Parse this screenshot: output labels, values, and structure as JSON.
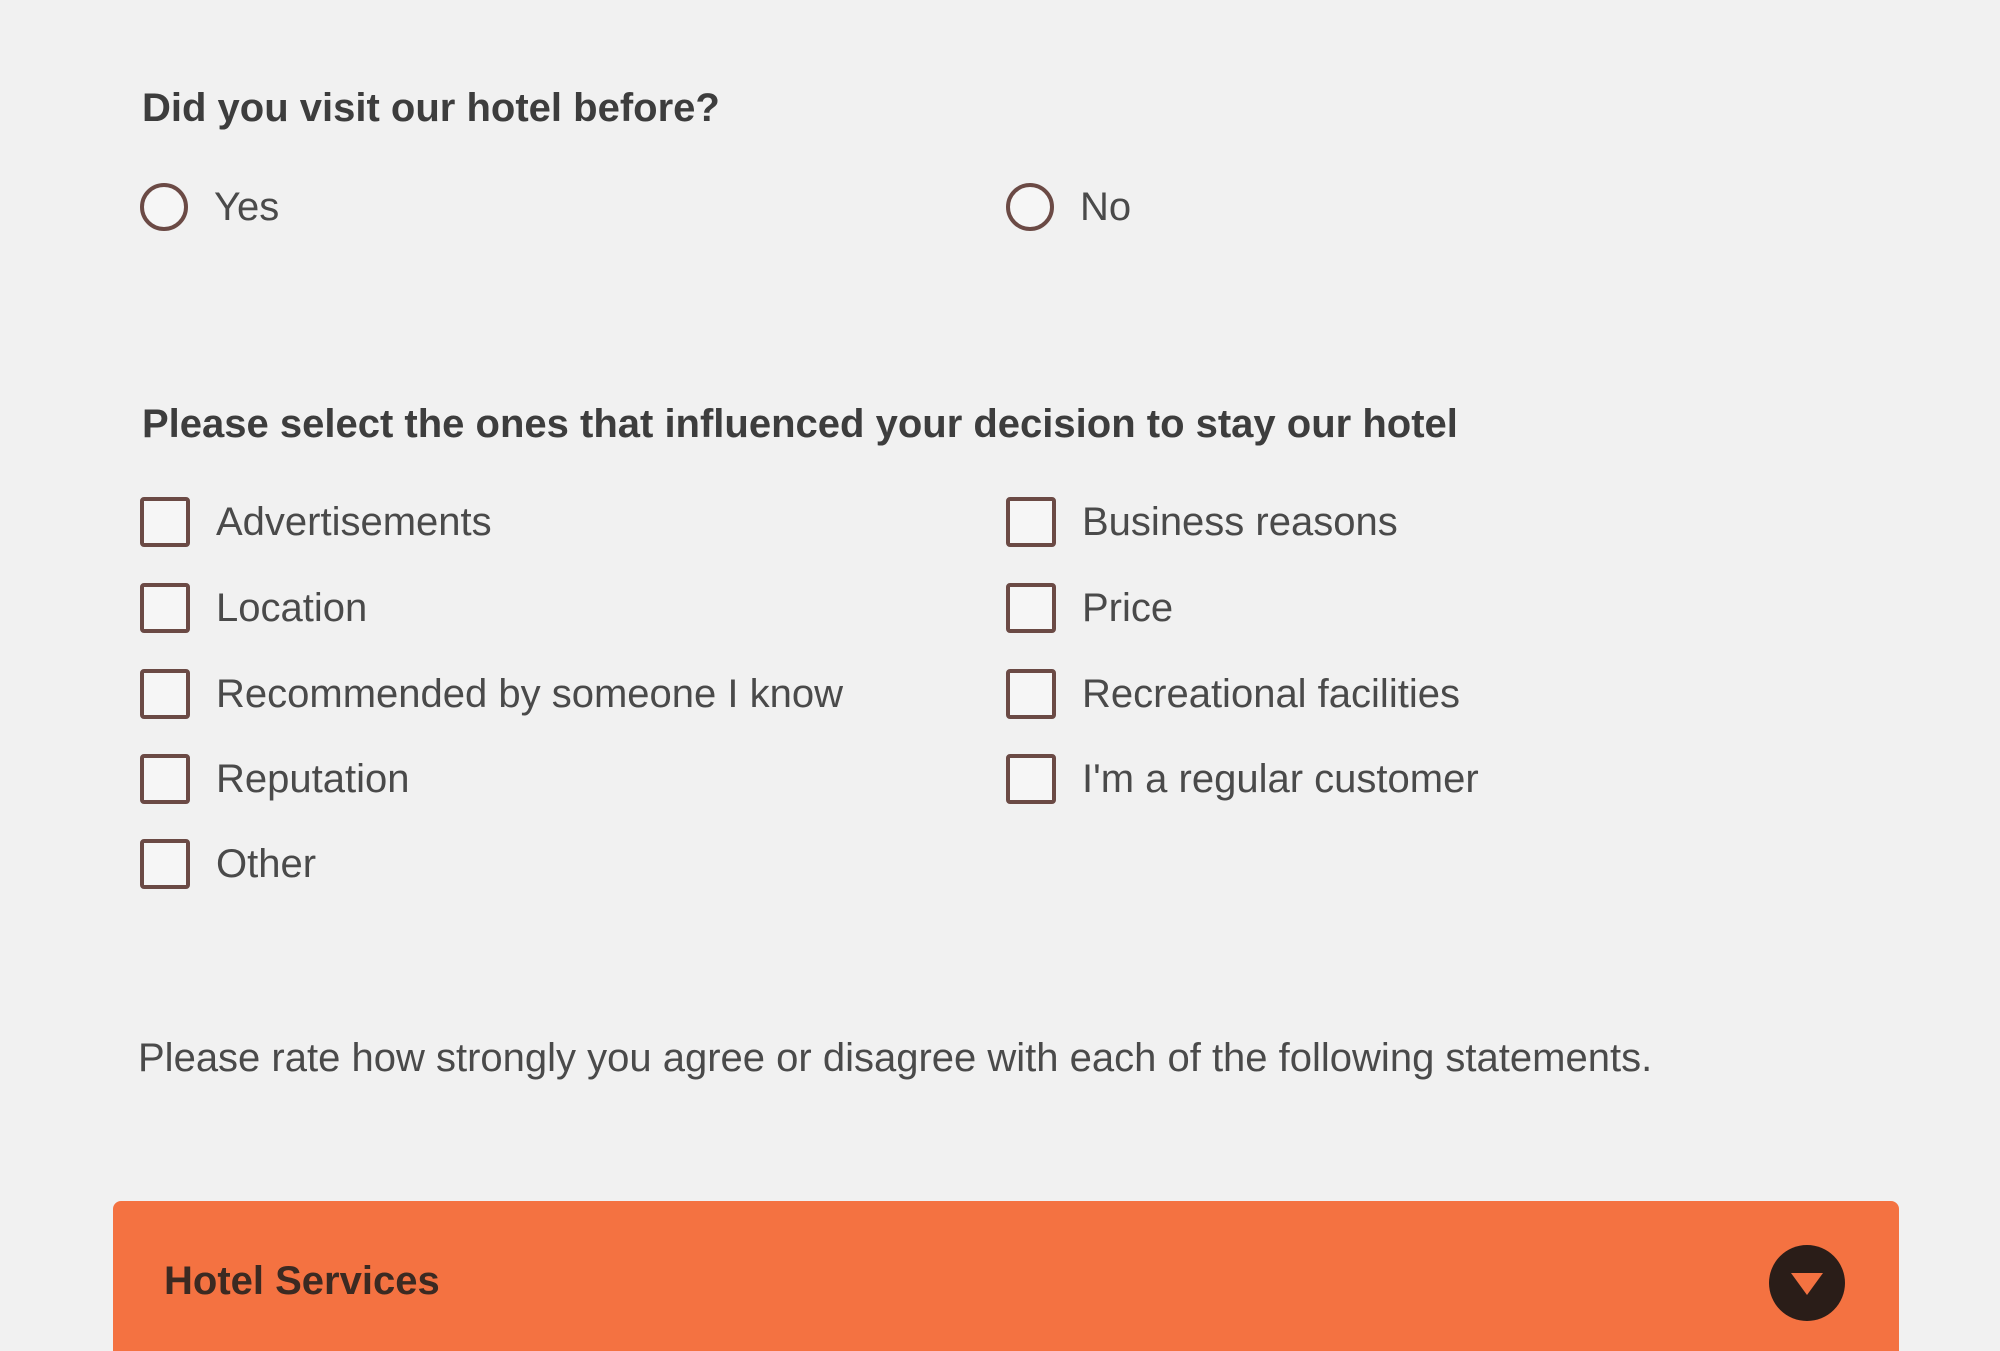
{
  "questions": {
    "visited_before": {
      "title": "Did you visit our hotel before?",
      "options": [
        "Yes",
        "No"
      ]
    },
    "influences": {
      "title": "Please select the ones that influenced your decision to stay our hotel",
      "left_options": [
        "Advertisements",
        "Location",
        "Recommended by someone I know",
        "Reputation",
        "Other"
      ],
      "right_options": [
        "Business reasons",
        "Price",
        "Recreational facilities",
        "I'm a regular customer"
      ]
    }
  },
  "rating": {
    "instruction": "Please rate how strongly you agree or disagree with each of the following statements."
  },
  "section": {
    "title": "Hotel Services",
    "toggle_icon": "chevron-down-icon",
    "color": "#f47241"
  }
}
